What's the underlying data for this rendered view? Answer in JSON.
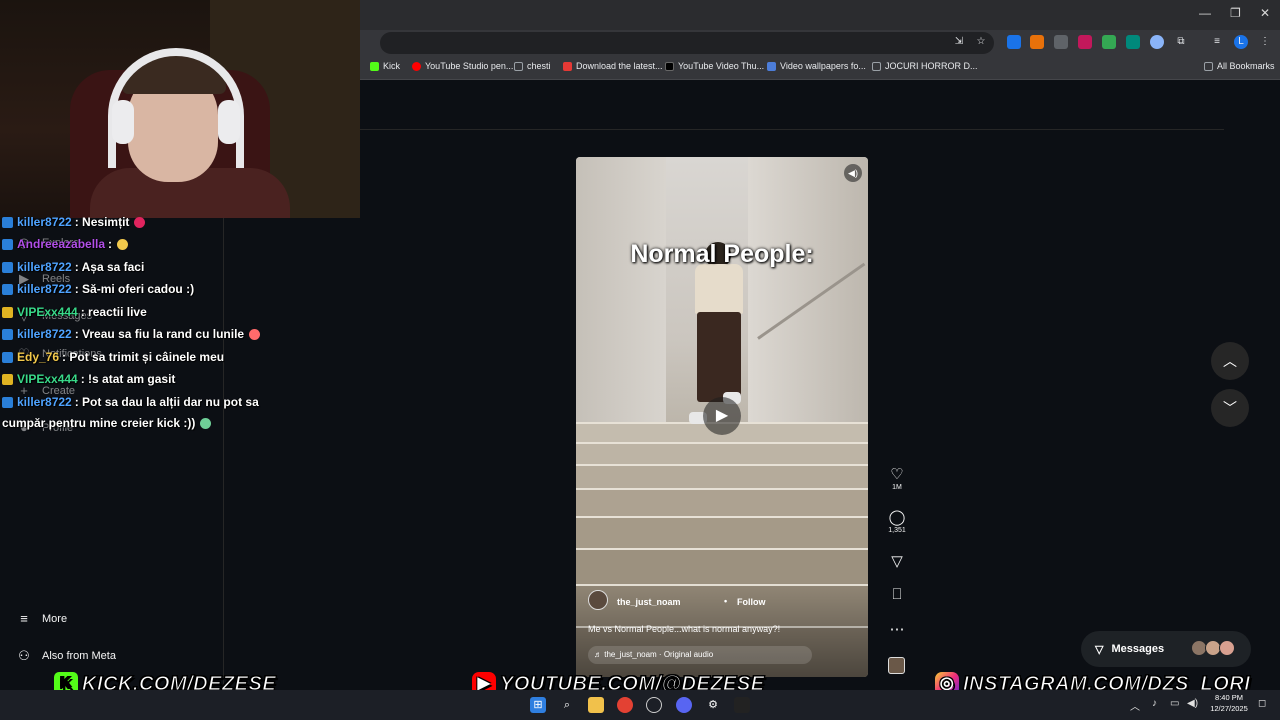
{
  "window": {
    "minimize": "—",
    "restore": "❐",
    "close": "✕"
  },
  "bookmarks": [
    {
      "label": "Kick",
      "color": "#53fc18"
    },
    {
      "label": "YouTube Studio pen...",
      "color": "#ff0000"
    },
    {
      "label": "chesti",
      "color": "#9aa0a6"
    },
    {
      "label": "Download the latest...",
      "color": "#e53935"
    },
    {
      "label": "YouTube Video Thu...",
      "color": "#202124"
    },
    {
      "label": "Video wallpapers fo...",
      "color": "#4c7dd9"
    },
    {
      "label": "JOCURI HORROR D...",
      "color": "#9aa0a6"
    },
    {
      "label": "All Bookmarks",
      "color": "#9aa0a6"
    }
  ],
  "ig": {
    "sidebar": {
      "explore": "Explore",
      "reels": "Reels",
      "messages": "Messages",
      "notifications": "Notifications",
      "create": "Create",
      "profile": "Profile",
      "more": "More",
      "also_from_meta": "Also from Meta"
    },
    "reel": {
      "title": "Normal People:",
      "username": "the_just_noam",
      "follow": "Follow",
      "dot": "•",
      "caption": "Me vs Normal People...what is normal anyway?!",
      "audio": "♬ the_just_noam · Original audio",
      "likes": "1M",
      "comments": "1,351"
    },
    "messages_label": "Messages"
  },
  "chat": [
    {
      "badge": "mod",
      "user": "killer8722",
      "user_color": "#4fa3ff",
      "text": ": Nesimțit",
      "emote": "#e0245e"
    },
    {
      "badge": "mod",
      "user": "Andreeazabella",
      "user_color": "#b14fe8",
      "text": ":",
      "emote": "#f2c94c"
    },
    {
      "badge": "mod",
      "user": "killer8722",
      "user_color": "#4fa3ff",
      "text": ": Așa sa faci",
      "emote": ""
    },
    {
      "badge": "mod",
      "user": "killer8722",
      "user_color": "#4fa3ff",
      "text": ": Să-mi oferi cadou :)",
      "emote": ""
    },
    {
      "badge": "vip",
      "user": "VIPExx444",
      "user_color": "#39d98a",
      "text": ": reactii live",
      "emote": ""
    },
    {
      "badge": "mod",
      "user": "killer8722",
      "user_color": "#4fa3ff",
      "text": ": Vreau sa fiu la rand cu lunile",
      "emote": "#ff6b6b"
    },
    {
      "badge": "mod",
      "user": "Edy_76",
      "user_color": "#f2c94c",
      "text": ": Pot sa trimit și câinele meu",
      "emote": ""
    },
    {
      "badge": "vip",
      "user": "VIPExx444",
      "user_color": "#39d98a",
      "text": ": !s atat am gasit",
      "emote": ""
    },
    {
      "badge": "mod",
      "user": "killer8722",
      "user_color": "#4fa3ff",
      "text": ": Pot sa dau la alții dar nu pot sa",
      "emote": ""
    },
    {
      "badge": "",
      "user": "",
      "user_color": "#ffffff",
      "text": "cumpăr pentru mine creier kick :))",
      "emote": "#6fcf97"
    }
  ],
  "banner": {
    "kick": "KICK.COM/DEZESE",
    "youtube": "YOUTUBE.COM/@DEZESE",
    "instagram": "INSTAGRAM.COM/DZS_LORI"
  },
  "taskbar": {
    "time": "8:40 PM",
    "date": "12/27/2025"
  }
}
